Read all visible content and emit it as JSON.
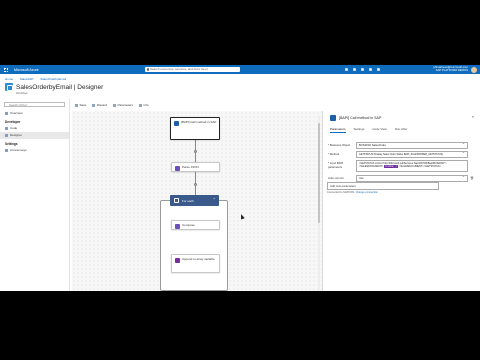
{
  "topbar": {
    "brand": "Microsoft Azure",
    "search_placeholder": "Search resources, services, and docs (G+/)",
    "account_line1": "phmathews@microsoft.com",
    "account_line2": "SAP PLATFORM DEMOS",
    "accent": "#0f6cbd"
  },
  "breadcrumb": [
    "Home",
    "SalesSAP",
    "SalesOrderbyEmail"
  ],
  "page": {
    "title": "SalesOrderbyEmail | Designer",
    "subtitle": "Workflow"
  },
  "toolbar": {
    "save": "Save",
    "discard": "Discard",
    "parameters": "Parameters",
    "info": "Info"
  },
  "leftnav": {
    "search_placeholder": "Search (Ctrl+/)",
    "overview": "Overview",
    "section_developer": "Developer",
    "code": "Code",
    "designer": "Designer",
    "section_settings": "Settings",
    "access_keys": "Access keys"
  },
  "canvas": {
    "node1": "[BAPI] Call method in SAP",
    "node2": "Parse JSON",
    "scope": "For each",
    "node3": "Compose",
    "node4": "Append to array variable"
  },
  "panel": {
    "title": "[BAPI] Call method in SAP",
    "tabs": [
      "Parameters",
      "Settings",
      "Code View",
      "Run After"
    ],
    "business_object_label": "* Business Object",
    "business_object_value": "BUS2032 SalesOrder",
    "method_label": "* Method",
    "method_value": "GETSTATUS (Display Sales Order Status BAPI_SALESORDER_GETSTATUS)",
    "input_label": "* Input BAPI parameters",
    "input_line1": "<GETSTATUS xmlns=\"http://Microsoft.LobServices.Sap/2007/03/Bapi/BUS2032/\">",
    "input_line2_pre": "<SALESDOCUMENT>",
    "input_chip": "fx  trim(...)",
    "input_line2_post": "</SALESDOCUMENT></GETSTATUS>",
    "autocommit_label": "Auto commit",
    "autocommit_value": "Yes",
    "add_new": "Add new parameters",
    "connected_to": "Connected to SAPCON.",
    "change_connection": "Change connection"
  }
}
